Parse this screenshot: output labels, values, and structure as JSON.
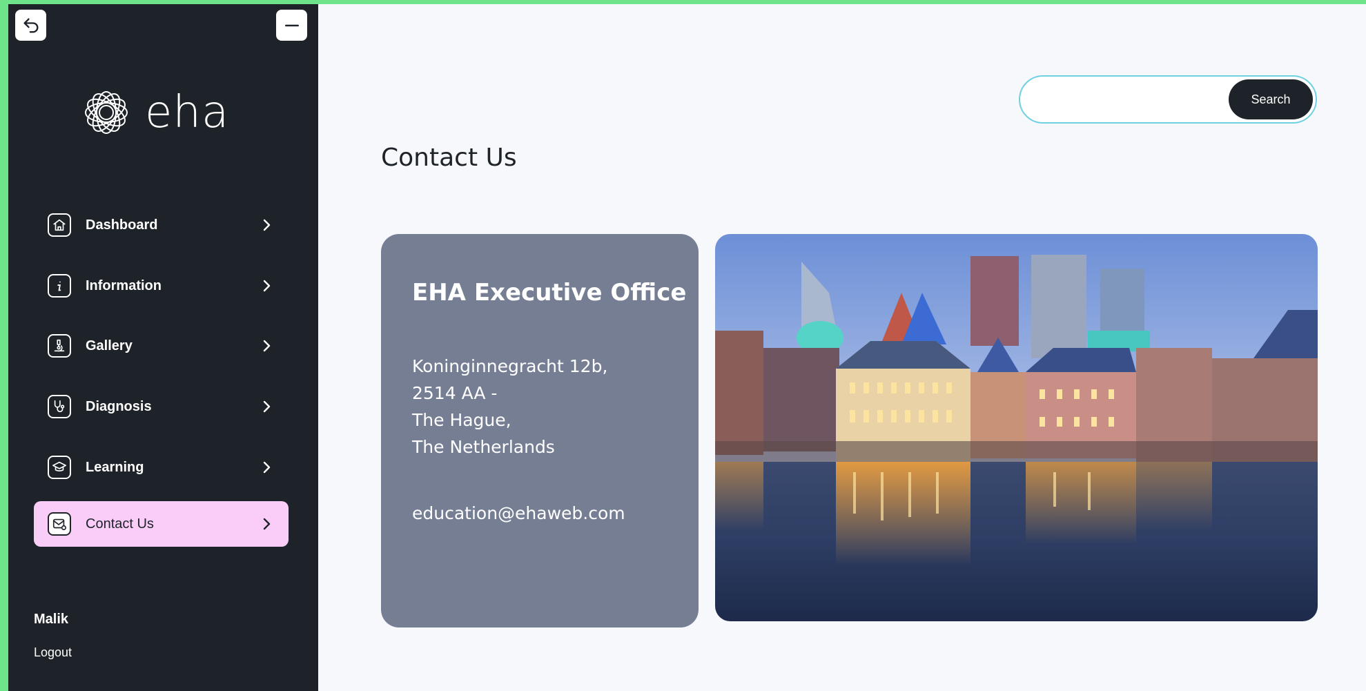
{
  "sidebar": {
    "logo_text": "eha",
    "items": [
      {
        "label": "Dashboard"
      },
      {
        "label": "Information"
      },
      {
        "label": "Gallery"
      },
      {
        "label": "Diagnosis"
      },
      {
        "label": "Learning"
      },
      {
        "label": "Contact Us",
        "active": true
      }
    ],
    "user_name": "Malik",
    "logout_label": "Logout"
  },
  "search": {
    "value": "",
    "button_label": "Search"
  },
  "main": {
    "page_title": "Contact Us",
    "office": {
      "name": "EHA Executive Office",
      "address_lines": [
        "Koninginnegracht 12b,",
        "2514 AA -",
        "The Hague,",
        "The Netherlands"
      ],
      "email": "education@ehaweb.com"
    }
  },
  "colors": {
    "accent_border": "#6ee38a",
    "sidebar_bg": "#1d2328",
    "active_item_bg": "#f9cdf7",
    "card_bg": "#767e94",
    "search_border": "#6fd0df"
  },
  "icons": {
    "back": "back-arrow-icon",
    "collapse": "minus-icon",
    "dashboard": "home-icon",
    "information": "info-icon",
    "gallery": "microscope-icon",
    "diagnosis": "stethoscope-icon",
    "learning": "graduation-cap-icon",
    "contact": "mail-icon"
  }
}
